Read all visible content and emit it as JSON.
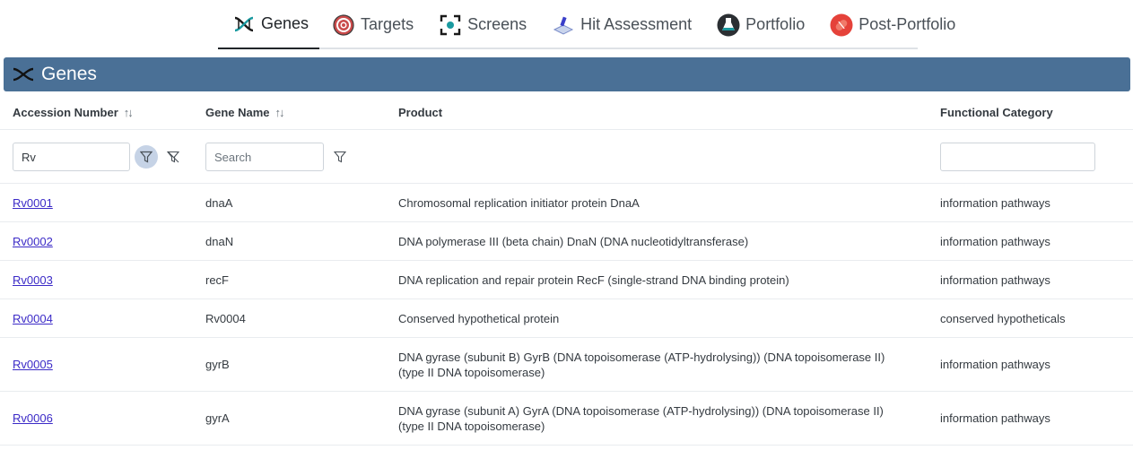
{
  "nav": {
    "tabs": [
      {
        "label": "Genes",
        "icon": "dna-icon",
        "active": true
      },
      {
        "label": "Targets",
        "icon": "target-icon"
      },
      {
        "label": "Screens",
        "icon": "screen-icon"
      },
      {
        "label": "Hit Assessment",
        "icon": "hit-assessment-icon"
      },
      {
        "label": "Portfolio",
        "icon": "flask-icon"
      },
      {
        "label": "Post-Portfolio",
        "icon": "pill-icon"
      }
    ]
  },
  "header": {
    "title": "Genes",
    "color": "#4a7096"
  },
  "table": {
    "columns": {
      "accession": "Accession Number",
      "gene_name": "Gene Name",
      "product": "Product",
      "functional_category": "Functional Category"
    },
    "sort_glyph": "↑↓",
    "filters": {
      "accession_value": "Rv",
      "gene_name_placeholder": "Search",
      "functional_category_value": ""
    },
    "rows": [
      {
        "accession": "Rv0001",
        "gene_name": "dnaA",
        "product": "Chromosomal replication initiator protein DnaA",
        "functional_category": "information pathways"
      },
      {
        "accession": "Rv0002",
        "gene_name": "dnaN",
        "product": "DNA polymerase III (beta chain) DnaN (DNA nucleotidyltransferase)",
        "functional_category": "information pathways"
      },
      {
        "accession": "Rv0003",
        "gene_name": "recF",
        "product": "DNA replication and repair protein RecF (single-strand DNA binding protein)",
        "functional_category": "information pathways"
      },
      {
        "accession": "Rv0004",
        "gene_name": "Rv0004",
        "product": "Conserved hypothetical protein",
        "functional_category": "conserved hypotheticals"
      },
      {
        "accession": "Rv0005",
        "gene_name": "gyrB",
        "product": "DNA gyrase (subunit B) GyrB (DNA topoisomerase (ATP-hydrolysing)) (DNA topoisomerase II) (type II DNA topoisomerase)",
        "functional_category": "information pathways"
      },
      {
        "accession": "Rv0006",
        "gene_name": "gyrA",
        "product": "DNA gyrase (subunit A) GyrA (DNA topoisomerase (ATP-hydrolysing)) (DNA topoisomerase II) (type II DNA topoisomerase)",
        "functional_category": "information pathways"
      }
    ]
  }
}
